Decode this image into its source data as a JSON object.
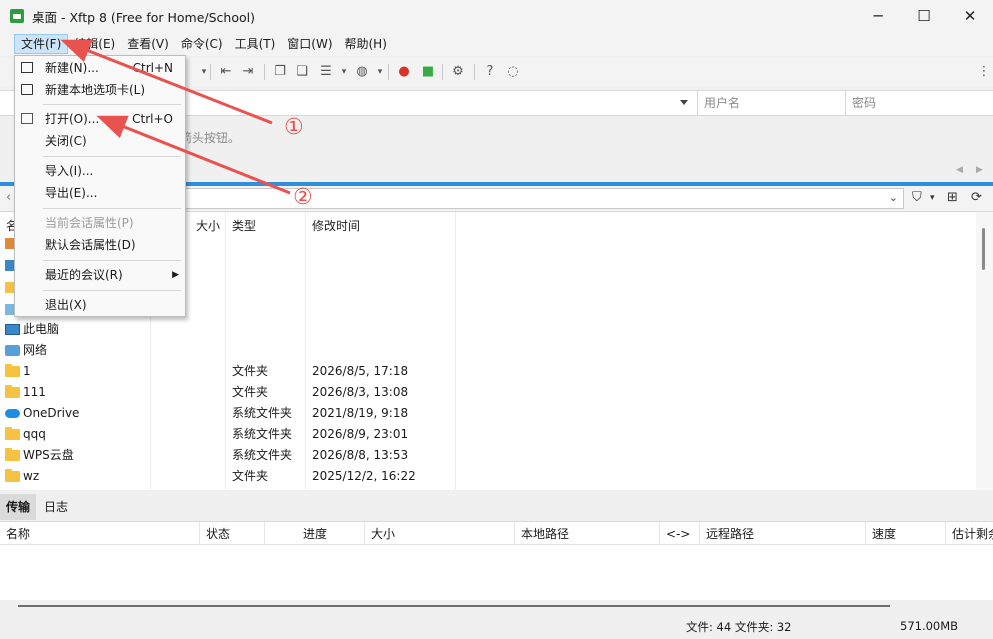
{
  "window": {
    "title": "桌面 - Xftp 8 (Free for Home/School)",
    "controls": [
      "minimize",
      "maximize",
      "close"
    ]
  },
  "menubar": {
    "items": [
      "文件(F)",
      "编辑(E)",
      "查看(V)",
      "命令(C)",
      "工具(T)",
      "窗口(W)",
      "帮助(H)"
    ]
  },
  "address": {
    "user_placeholder": "用户名",
    "password_placeholder": "密码"
  },
  "hint": {
    "text": "的箭头按钮。"
  },
  "file_menu": {
    "items": [
      {
        "label": "新建(N)...",
        "shortcut": "Ctrl+N",
        "icon": "new-session-icon"
      },
      {
        "label": "新建本地选项卡(L)",
        "icon": "new-tab-icon"
      },
      {
        "label": "打开(O)...",
        "shortcut": "Ctrl+O",
        "icon": "open-icon"
      },
      {
        "label": "关闭(C)"
      },
      {
        "label": "导入(I)..."
      },
      {
        "label": "导出(E)..."
      },
      {
        "label": "当前会话属性(P)",
        "disabled": true
      },
      {
        "label": "默认会话属性(D)"
      },
      {
        "label": "最近的会议(R)",
        "submenu": true
      },
      {
        "label": "退出(X)"
      }
    ]
  },
  "filelist": {
    "columns": {
      "name": "名",
      "size": "大小",
      "type": "类型",
      "mtime": "修改时间"
    },
    "rows": [
      {
        "name": "此电脑",
        "type": "",
        "mtime": "",
        "icon": "computer-icon"
      },
      {
        "name": "网络",
        "type": "",
        "mtime": "",
        "icon": "network-icon"
      },
      {
        "name": "1",
        "type": "文件夹",
        "mtime": "2026/8/5, 17:18",
        "icon": "folder-icon"
      },
      {
        "name": "111",
        "type": "文件夹",
        "mtime": "2026/8/3, 13:08",
        "icon": "folder-icon"
      },
      {
        "name": "OneDrive",
        "type": "系统文件夹",
        "mtime": "2021/8/19, 9:18",
        "icon": "onedrive-icon"
      },
      {
        "name": "qqq",
        "type": "系统文件夹",
        "mtime": "2026/8/9, 23:01",
        "icon": "folder-icon"
      },
      {
        "name": "WPS云盘",
        "type": "系统文件夹",
        "mtime": "2026/8/8, 13:53",
        "icon": "folder-icon"
      },
      {
        "name": "wz",
        "type": "文件夹",
        "mtime": "2025/12/2, 16:22",
        "icon": "folder-icon"
      }
    ]
  },
  "bottom_tabs": [
    "传输",
    "日志"
  ],
  "transfer": {
    "columns": [
      "名称",
      "状态",
      "进度",
      "大小",
      "本地路径",
      "<->",
      "远程路径",
      "速度",
      "估计剩余"
    ]
  },
  "status": {
    "counts": "文件: 44  文件夹: 32",
    "size": "571.00MB"
  },
  "annotations": {
    "marker1": "①",
    "marker2": "②",
    "color": "#e8524f"
  }
}
